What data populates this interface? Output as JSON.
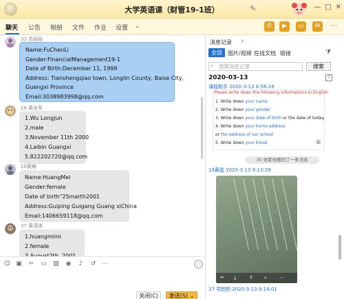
{
  "window": {
    "title": "大学英语课（财管19-1班）",
    "controls": [
      "—",
      "□",
      "✕"
    ]
  },
  "tabs": [
    {
      "label": "聊天",
      "active": true
    },
    {
      "label": "公告"
    },
    {
      "label": "相册"
    },
    {
      "label": "文件"
    },
    {
      "label": "作业"
    },
    {
      "label": "设置"
    }
  ],
  "tab_more": "⌄",
  "messages": [
    {
      "sender": "33 苏丽丽",
      "lines": [
        "Name:FuChenLi",
        "Gender:FinancialManagement19-1",
        "Date of Birth:December 11, 1999",
        "Address:  Tianshengqiao town, Longlin County, Baise City,",
        "Guangxi Province",
        "Email:3038983998@qq.com"
      ]
    },
    {
      "sender": "26 黄龙军",
      "lines": [
        "1.Wu Longjun",
        "2.male",
        "3.November  11th  2000",
        "4.Laibin  Guangxi",
        "5.822202720@qq.com"
      ]
    },
    {
      "sender": "28黄梅",
      "lines": [
        "Name:HuangMei",
        "Gender:female",
        "Date of birth\"25marth2001",
        "Address:Guiping Guigang  Guang xiChina",
        "Email:1406659118@qq.com"
      ]
    },
    {
      "sender": "37 黄语迷",
      "lines": [
        "1.huangmimi",
        "2.female",
        "3.August2th,  2001"
      ]
    }
  ],
  "composer": {
    "close_label": "关闭(C)",
    "send_label": "发送(S)",
    "send_dropdown": "⌄"
  },
  "history": {
    "title": "消息记录",
    "close": "×",
    "tabs": [
      "全部",
      "图片/视频",
      "在线文档",
      "链接"
    ],
    "search_placeholder": "搜索消息记录",
    "search_button": "搜索",
    "date": "2020-03-13",
    "cut_header": "课程助手 2020-3-13 8:56:16",
    "card": {
      "heading": "Please write down the following informations in English.",
      "items": [
        {
          "pre": "1. Write down ",
          "hl": "your name",
          "post": ""
        },
        {
          "pre": "2. Write down ",
          "hl": "your gender",
          "post": ""
        },
        {
          "pre": "3. Write down ",
          "hl": "your date of birth",
          "post": " or the date of today."
        },
        {
          "pre": "4. Write down ",
          "hl": "your home address",
          "post": ""
        },
        {
          "pre": "            or ",
          "hl": "the address of our school",
          "post": ""
        },
        {
          "pre": "5. Write down ",
          "hl": "your Email",
          "post": ""
        }
      ]
    },
    "recall_notice": "30 张紫纹撤回了一条消息",
    "entry1_user": "19黄晶 2020-3-13 9:13:39",
    "entry2_user": "17 项韵韵 2020-3-13 9:14:01"
  }
}
